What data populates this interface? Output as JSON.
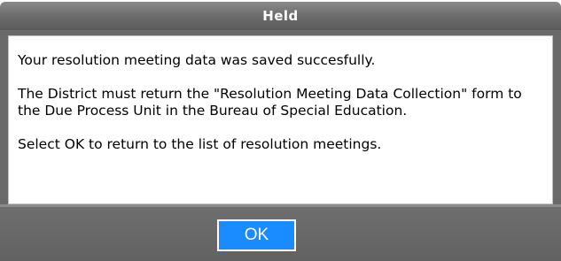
{
  "dialog": {
    "title": "Held",
    "messages": [
      "Your resolution meeting data was saved succesfully.",
      "The District must return the \"Resolution Meeting Data Collection\" form to the Due Process Unit in the Bureau of Special Education.",
      "Select OK to return to the list of resolution meetings."
    ],
    "ok_label": "OK"
  },
  "colors": {
    "titlebar": "#6e6e6e",
    "button": "#1a8cff",
    "frame": "#6a6a6a"
  }
}
